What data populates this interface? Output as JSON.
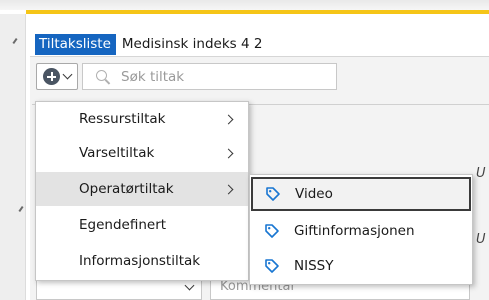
{
  "tabs": [
    {
      "label": "Tiltaksliste",
      "active": true
    },
    {
      "label": "Medisinsk indeks 4 2",
      "active": false
    }
  ],
  "toolbar": {
    "add_button_icon": "plus-circle-icon",
    "search_placeholder": "Søk tiltak"
  },
  "menu": {
    "items": [
      {
        "label": "Ressurstiltak",
        "has_submenu": true
      },
      {
        "label": "Varseltiltak",
        "has_submenu": true
      },
      {
        "label": "Operatørtiltak",
        "has_submenu": true,
        "highlighted": true
      },
      {
        "label": "Egendefinert",
        "has_submenu": false
      },
      {
        "label": "Informasjonstiltak",
        "has_submenu": false
      }
    ]
  },
  "submenu": {
    "items": [
      {
        "label": "Video",
        "icon": "tag-icon",
        "selected": true
      },
      {
        "label": "Giftinformasjonen",
        "icon": "tag-icon",
        "selected": false
      },
      {
        "label": "NISSY",
        "icon": "tag-icon",
        "selected": false
      }
    ]
  },
  "background": {
    "italic_fragment_1": "U",
    "italic_fragment_2": "U",
    "comment_placeholder": "Kommentar"
  },
  "colors": {
    "accent_yellow": "#f5c518",
    "active_tab": "#1565c0",
    "tag_icon": "#1976d2"
  }
}
